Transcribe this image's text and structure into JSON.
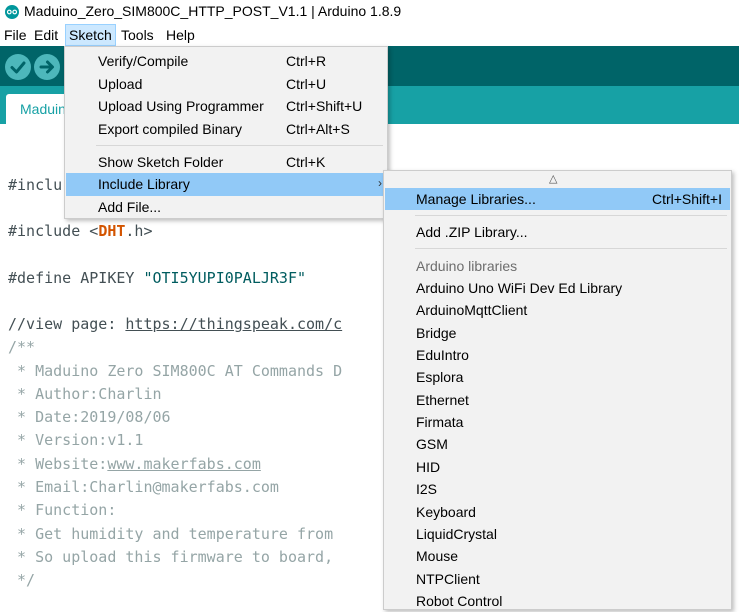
{
  "window": {
    "title": "Maduino_Zero_SIM800C_HTTP_POST_V1.1 | Arduino 1.8.9"
  },
  "menubar": [
    "File",
    "Edit",
    "Sketch",
    "Tools",
    "Help"
  ],
  "tabs": {
    "active": "Maduino"
  },
  "code": {
    "l1_prefix": "#inclu",
    "l2_pre": "#include <",
    "l2_kw": "DHT",
    "l2_post": ".h>",
    "l3_pre": "#define APIKEY ",
    "l3_str": "\"OTI5YUPI0PALJR3F\"",
    "l4_pre": "//view page: ",
    "l4_link": "https://thingspeak.com/c",
    "l5": "/**",
    "l6": " * Maduino Zero SIM800C AT Commands D",
    "l7": " * Author:Charlin",
    "l8": " * Date:2019/08/06",
    "l9": " * Version:v1.1",
    "l10_pre": " * Website:",
    "l10_link": "www.makerfabs.com",
    "l11": " * Email:Charlin@makerfabs.com",
    "l12": " * Function:",
    "l13": " * Get humidity and temperature from ",
    "l14": " * So upload this firmware to board, ",
    "l15": " */"
  },
  "sketch_menu": {
    "items": [
      {
        "label": "Verify/Compile",
        "shortcut": "Ctrl+R"
      },
      {
        "label": "Upload",
        "shortcut": "Ctrl+U"
      },
      {
        "label": "Upload Using Programmer",
        "shortcut": "Ctrl+Shift+U"
      },
      {
        "label": "Export compiled Binary",
        "shortcut": "Ctrl+Alt+S"
      },
      {
        "label": "Show Sketch Folder",
        "shortcut": "Ctrl+K"
      },
      {
        "label": "Include Library",
        "shortcut": ""
      },
      {
        "label": "Add File...",
        "shortcut": ""
      }
    ],
    "submenu_arrow": "›"
  },
  "library_menu": {
    "scroll_up": "△",
    "manage": {
      "label": "Manage Libraries...",
      "shortcut": "Ctrl+Shift+I"
    },
    "add_zip": "Add .ZIP Library...",
    "header": "Arduino libraries",
    "libraries": [
      "Arduino Uno WiFi Dev Ed Library",
      "ArduinoMqttClient",
      "Bridge",
      "EduIntro",
      "Esplora",
      "Ethernet",
      "Firmata",
      "GSM",
      "HID",
      "I2S",
      "Keyboard",
      "LiquidCrystal",
      "Mouse",
      "NTPClient",
      "Robot Control"
    ]
  },
  "colors": {
    "toolbar": "#006468",
    "tabbar": "#17a1a5",
    "menu_highlight": "#91c9f7"
  }
}
